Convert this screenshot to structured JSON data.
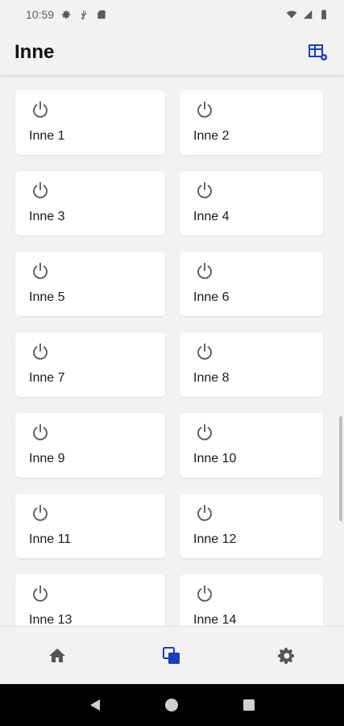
{
  "status_bar": {
    "time": "10:59",
    "icons": [
      "settings-icon",
      "usb-icon",
      "sd-card-icon",
      "wifi-icon",
      "signal-icon",
      "battery-icon"
    ]
  },
  "app_bar": {
    "title": "Inne",
    "action_icon": "grid-settings-icon"
  },
  "tiles": [
    {
      "label": "Inne 1",
      "icon": "power-icon"
    },
    {
      "label": "Inne 2",
      "icon": "power-icon"
    },
    {
      "label": "Inne 3",
      "icon": "power-icon"
    },
    {
      "label": "Inne 4",
      "icon": "power-icon"
    },
    {
      "label": "Inne 5",
      "icon": "power-icon"
    },
    {
      "label": "Inne 6",
      "icon": "power-icon"
    },
    {
      "label": "Inne 7",
      "icon": "power-icon"
    },
    {
      "label": "Inne 8",
      "icon": "power-icon"
    },
    {
      "label": "Inne 9",
      "icon": "power-icon"
    },
    {
      "label": "Inne 10",
      "icon": "power-icon"
    },
    {
      "label": "Inne 11",
      "icon": "power-icon"
    },
    {
      "label": "Inne 12",
      "icon": "power-icon"
    },
    {
      "label": "Inne 13",
      "icon": "power-icon"
    },
    {
      "label": "Inne 14",
      "icon": "power-icon"
    }
  ],
  "bottom_nav": {
    "items": [
      {
        "icon": "home-icon",
        "active": false
      },
      {
        "icon": "devices-icon",
        "active": true
      },
      {
        "icon": "gear-icon",
        "active": false
      }
    ]
  },
  "colors": {
    "accent": "#1a3fb8",
    "icon_gray": "#555555",
    "background": "#f2f2f2",
    "card": "#ffffff"
  }
}
